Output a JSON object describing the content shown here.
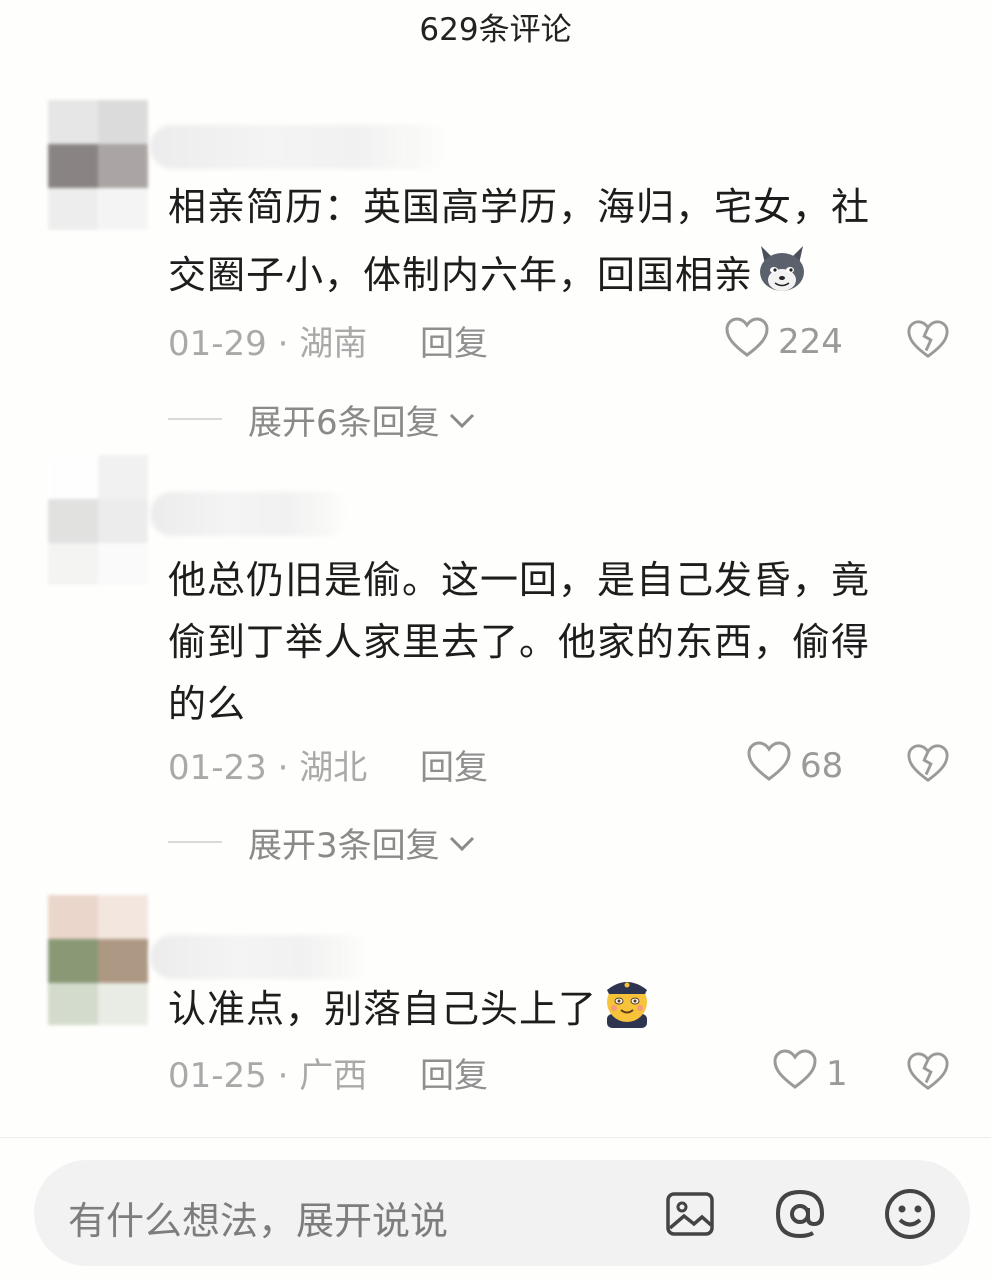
{
  "header": {
    "title": "629条评论"
  },
  "comments": [
    {
      "text_lines": [
        "相亲简历：英国高学历，海归，宅女，社",
        "交圈子小，体制内六年，回国相亲"
      ],
      "emoji": "husky-emoji",
      "date": "01-29 · 湖南",
      "reply_label": "回复",
      "likes": "224",
      "expand_label": "展开6条回复"
    },
    {
      "text_lines": [
        "他总仍旧是偷。这一回，是自己发昏，竟",
        "偷到丁举人家里去了。他家的东西，偷得",
        "的么"
      ],
      "date": "01-23 · 湖北",
      "reply_label": "回复",
      "likes": "68",
      "expand_label": "展开3条回复"
    },
    {
      "text_lines": [
        "认准点，别落自己头上了"
      ],
      "emoji": "officer-smile-emoji",
      "date": "01-25 · 广西",
      "reply_label": "回复",
      "likes": "1"
    }
  ],
  "input_bar": {
    "placeholder": "有什么想法，展开说说",
    "icons": [
      "image-icon",
      "at-icon",
      "emoji-icon"
    ]
  },
  "colors": {
    "background": "#fefefc",
    "meta_text": "#a9a9a9",
    "input_bg": "#f2f2f2"
  }
}
